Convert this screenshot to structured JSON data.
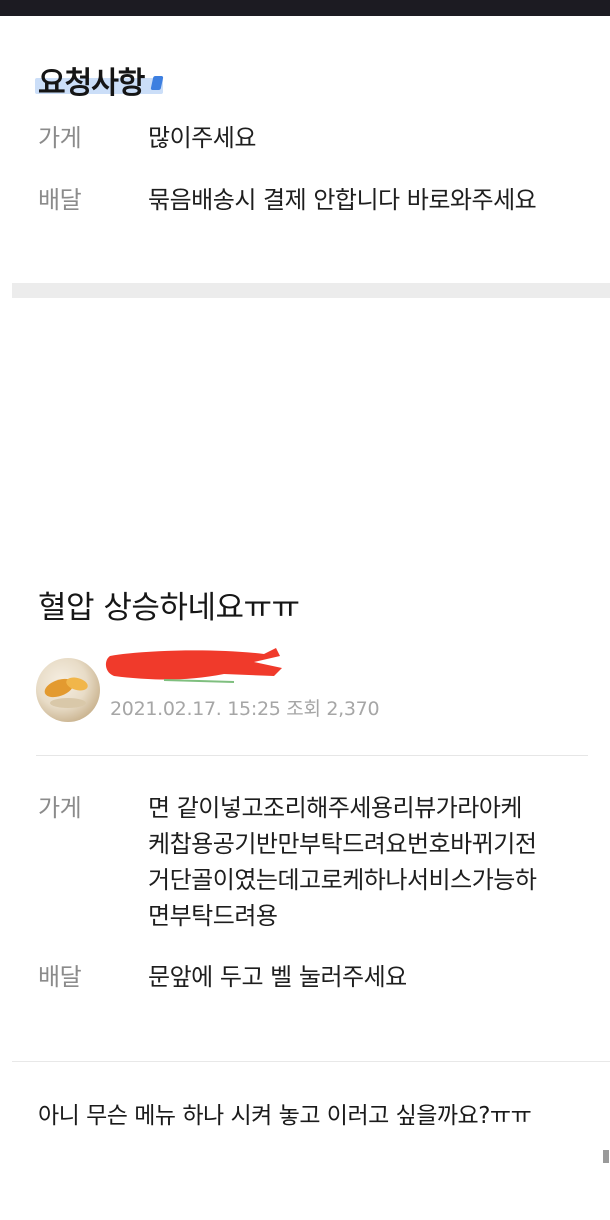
{
  "request": {
    "title": "요청사항",
    "rows": [
      {
        "label": "가게",
        "value": "많이주세요"
      },
      {
        "label": "배달",
        "value": "묶음배송시 결제 안합니다 바로와주세요"
      }
    ]
  },
  "post": {
    "title": "혈압 상승하네요ㅠㅠ",
    "meta": "2021.02.17. 15:25 조회 2,370",
    "rows": [
      {
        "label": "가게",
        "lines": [
          "면 같이넣고조리해주세용리뷰가라아케",
          "케찹용공기반만부탁드려요번호바뀌기전",
          "거단골이였는데고로케하나서비스가능하",
          "면부탁드려용"
        ]
      },
      {
        "label": "배달",
        "lines": [
          "문앞에 두고 벨 눌러주세요"
        ]
      }
    ],
    "comment": "아니 무슨 메뉴 하나 시켜 놓고 이러고 싶을까요?ㅠㅠ"
  },
  "colors": {
    "redaction": "#f03a2b",
    "highlight": "#b9d3f5",
    "band": "#ececec"
  }
}
